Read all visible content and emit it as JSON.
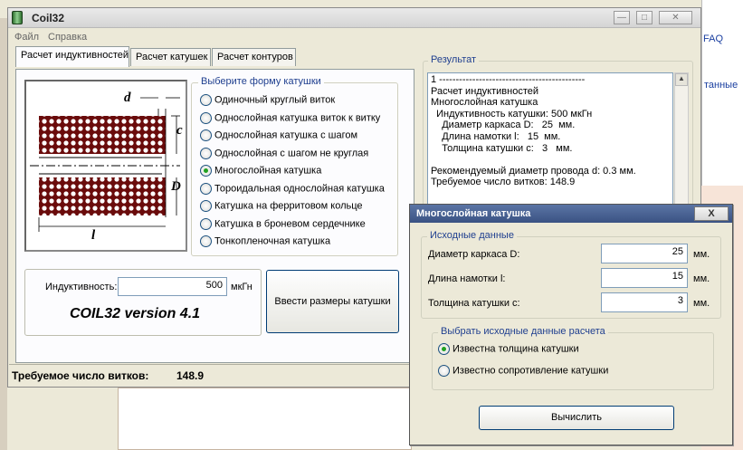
{
  "window": {
    "title": "Coil32"
  },
  "menu": [
    "Файл",
    "Справка"
  ],
  "tabs": [
    "Расчет индуктивностей",
    "Расчет катушек",
    "Расчет контуров"
  ],
  "diagram": {
    "d": "d",
    "c": "c",
    "D": "D",
    "l": "l"
  },
  "coil_form": {
    "legend": "Выберите форму катушки",
    "options": [
      "Одиночный круглый виток",
      "Однослойная катушка виток к витку",
      "Однослойная катушка с шагом",
      "Однослойная с шагом не круглая",
      "Многослойная катушка",
      "Тороидальная однослойная катушка",
      "Катушка на ферритовом кольце",
      "Катушка в броневом сердечнике",
      "Тонкопленочная катушка"
    ],
    "selected_index": 4
  },
  "inductance": {
    "label": "Индуктивность:",
    "value": "500",
    "unit": "мкГн"
  },
  "version": "COIL32 version 4.1",
  "enter_dims_button": "Ввести размеры катушки",
  "status": {
    "label": "Требуемое число витков:",
    "value": "148.9"
  },
  "result": {
    "legend": "Результат",
    "lines": [
      "1 --------------------------------------------",
      "Расчет индуктивностей",
      "Многослойная катушка",
      "  Индуктивность катушки: 500 мкГн",
      "    Диаметр каркаса D:   25  мм.",
      "    Длина намотки l:   15  мм.",
      "    Толщина катушки с:   3   мм.",
      "",
      "Рекомендуемый диаметр провода d: 0.3 мм.",
      "Требуемое число витков: 148.9"
    ]
  },
  "dialog": {
    "title": "Многослойная катушка",
    "close_label": "X",
    "source_legend": "Исходные данные",
    "fields": [
      {
        "label": "Диаметр каркаса D:",
        "value": "25",
        "unit": "мм."
      },
      {
        "label": "Длина намотки l:",
        "value": "15",
        "unit": "мм."
      },
      {
        "label": "Толщина катушки c:",
        "value": "3",
        "unit": "мм."
      }
    ],
    "choice_legend": "Выбрать исходные данные расчета",
    "choices": [
      "Известна толщина катушки",
      "Известно сопротивление катушки"
    ],
    "choice_selected": 0,
    "calc_button": "Вычислить"
  },
  "background": {
    "faq": "FAQ",
    "right_text": "танные"
  }
}
